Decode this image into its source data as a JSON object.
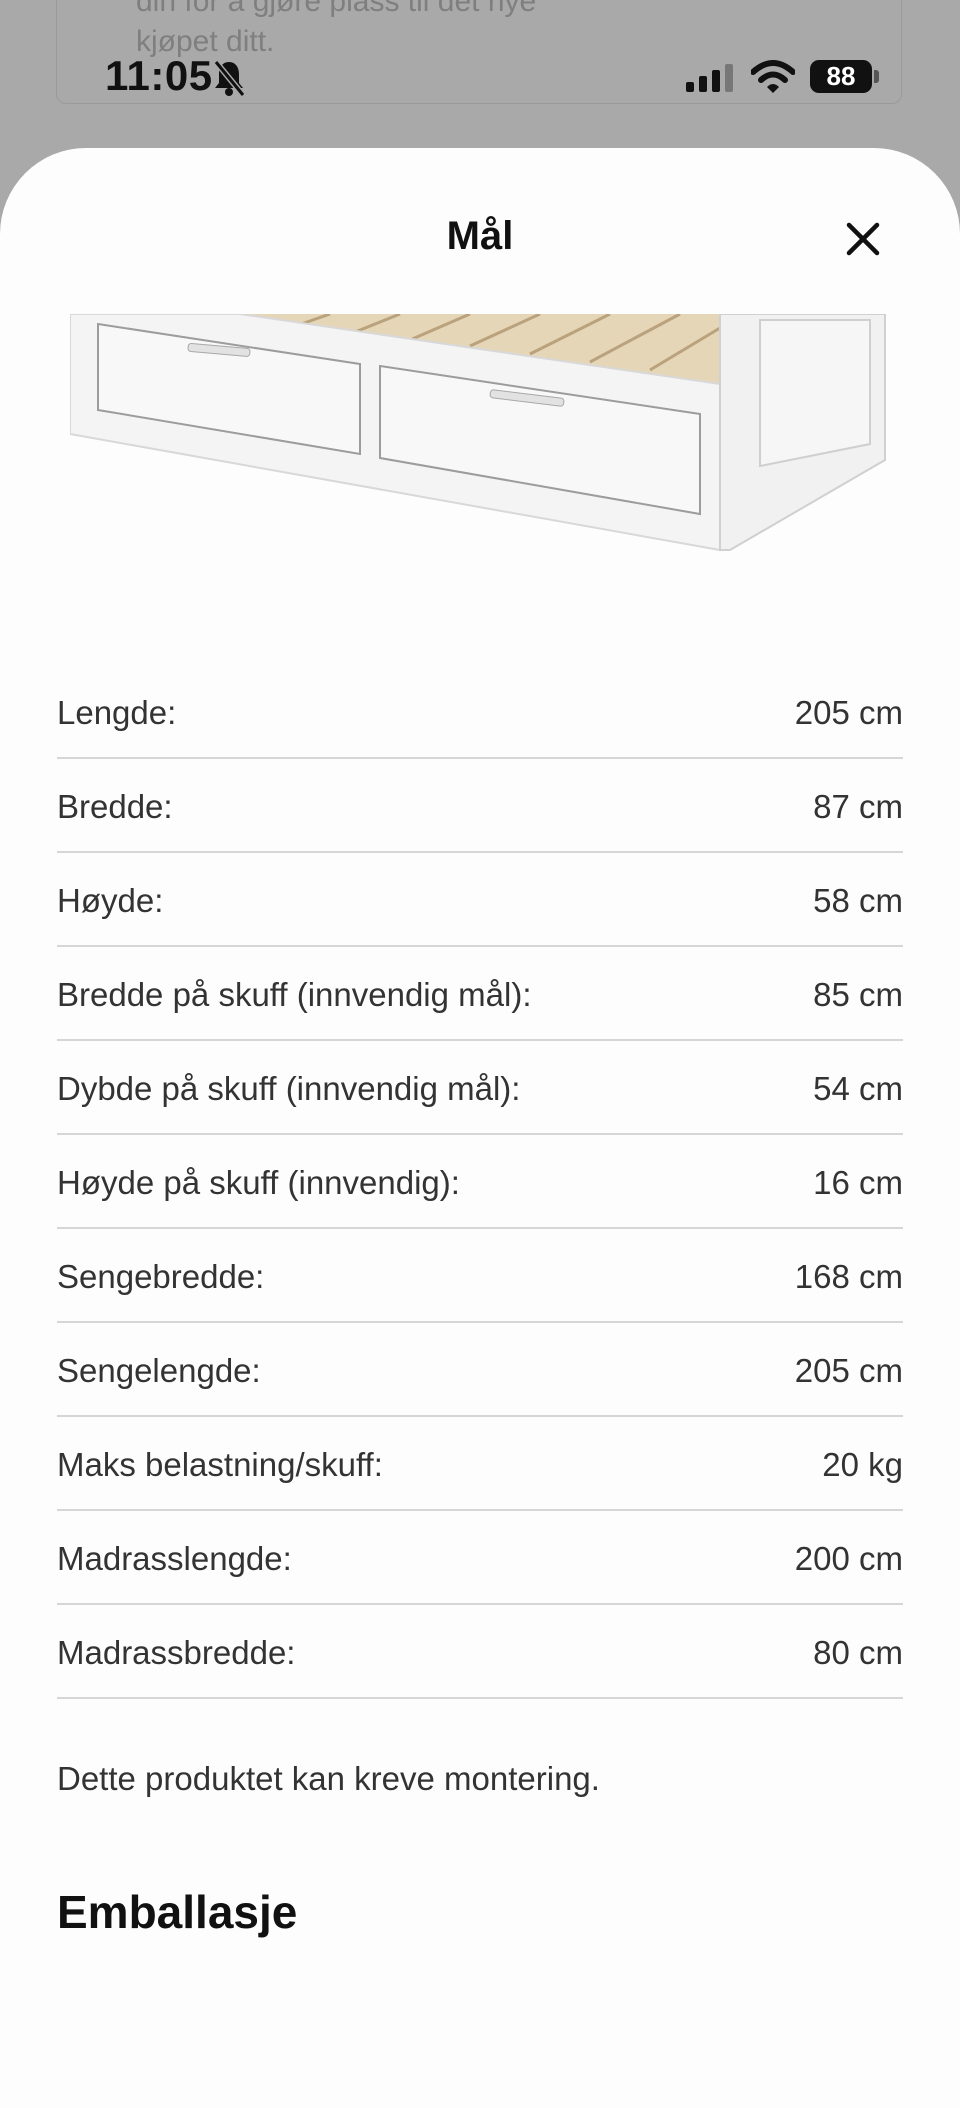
{
  "background": {
    "line1": "din for å gjøre plass til det nye",
    "line2": "kjøpet ditt."
  },
  "status_bar": {
    "time": "11:05",
    "battery": "88"
  },
  "sheet": {
    "title": "Mål",
    "close_icon": "close-icon"
  },
  "dimensions": [
    {
      "label": "Lengde:",
      "value": "205 cm"
    },
    {
      "label": "Bredde:",
      "value": "87 cm"
    },
    {
      "label": "Høyde:",
      "value": "58 cm"
    },
    {
      "label": "Bredde på skuff (innvendig mål):",
      "value": "85 cm"
    },
    {
      "label": "Dybde på skuff (innvendig mål):",
      "value": "54 cm"
    },
    {
      "label": "Høyde på skuff (innvendig):",
      "value": "16 cm"
    },
    {
      "label": "Sengebredde:",
      "value": "168 cm"
    },
    {
      "label": "Sengelengde:",
      "value": "205 cm"
    },
    {
      "label": "Maks belastning/skuff:",
      "value": "20 kg"
    },
    {
      "label": "Madrasslengde:",
      "value": "200 cm"
    },
    {
      "label": "Madrassbredde:",
      "value": "80 cm"
    }
  ],
  "note": "Dette produktet kan kreve montering.",
  "section_title": "Emballasje"
}
